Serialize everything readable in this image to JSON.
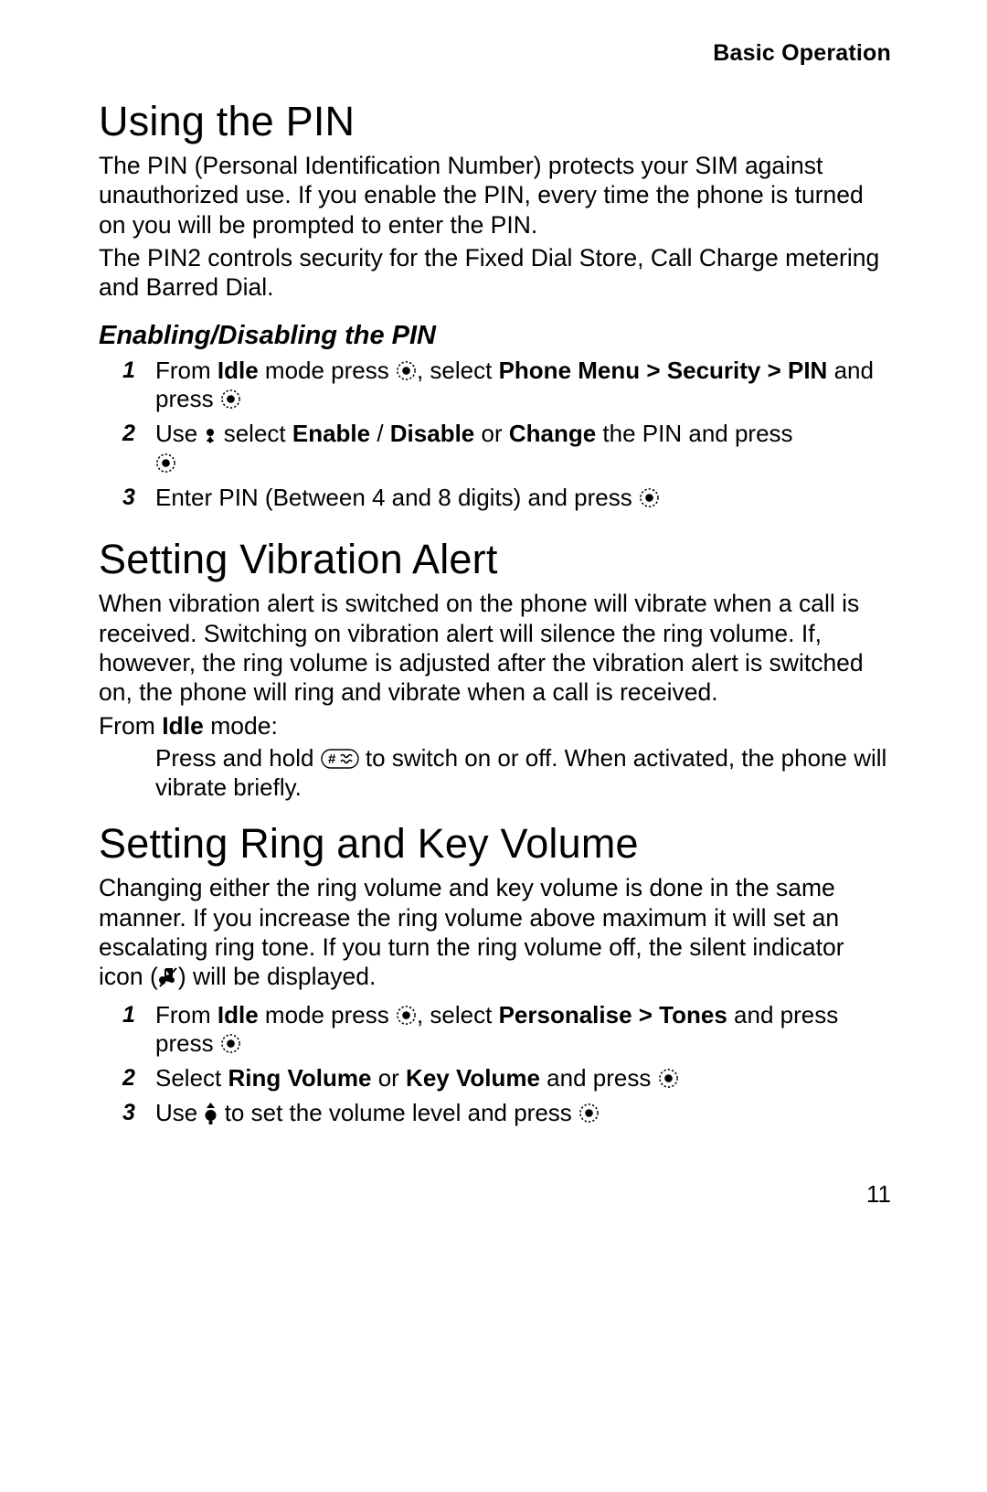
{
  "running_head": "Basic Operation",
  "page_number": "11",
  "sections": {
    "pin": {
      "heading": "Using the PIN",
      "p1": "The PIN (Personal Identification Number) protects your SIM against unauthorized use. If you enable the PIN, every time the phone is turned on you will be prompted to enter the PIN.",
      "p2": "The PIN2 controls security for the Fixed Dial Store, Call Charge metering and Barred Dial.",
      "sub": "Enabling/Disabling the PIN",
      "steps": {
        "n1": "1",
        "s1a": "From ",
        "s1_idle": "Idle",
        "s1b": " mode press ",
        "s1c": ", select ",
        "s1_path": "Phone Menu > Security > PIN",
        "s1d": " and press ",
        "n2": "2",
        "s2a": "Use ",
        "s2b": " select ",
        "s2_en": "Enable",
        "s2_slash": " / ",
        "s2_dis": "Disable",
        "s2_or": " or ",
        "s2_ch": "Change",
        "s2c": " the PIN and press ",
        "n3": "3",
        "s3a": "Enter PIN (Between 4 and 8 digits) and press "
      }
    },
    "vib": {
      "heading": "Setting Vibration Alert",
      "p1": "When vibration alert is switched on the phone will vibrate when a call is received. Switching on vibration alert will silence the ring volume. If, however, the ring volume is adjusted after the vibration alert is switched on, the phone will ring and vibrate when a call is received.",
      "lead_a": "From ",
      "lead_idle": "Idle",
      "lead_b": " mode:",
      "indent_a": "Press and hold ",
      "indent_b": " to switch on or off. When activated, the phone will vibrate briefly."
    },
    "vol": {
      "heading": "Setting Ring and Key Volume",
      "p1_a": "Changing either the ring volume and key volume is done in the same manner. If you increase the ring volume above maximum it will set an escalating ring tone. If you turn the ring volume off, the silent indicator icon (",
      "p1_b": ") will be displayed.",
      "steps": {
        "n1": "1",
        "s1a": "From ",
        "s1_idle": "Idle",
        "s1b": " mode press ",
        "s1c": ", select ",
        "s1_path": "Personalise > Tones",
        "s1d": " and press ",
        "n2": "2",
        "s2a": "Select ",
        "s2_rv": "Ring Volume",
        "s2_or": " or ",
        "s2_kv": "Key Volume",
        "s2b": " and press ",
        "n3": "3",
        "s3a": "Use ",
        "s3b": " to set the volume level and press "
      }
    }
  }
}
